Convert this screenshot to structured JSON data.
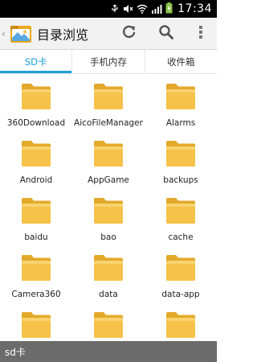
{
  "status_bar": {
    "time": "17:34",
    "icons": [
      "usb-icon",
      "mute-icon",
      "wifi-icon",
      "signal-icon",
      "battery-icon"
    ]
  },
  "action_bar": {
    "title": "目录浏览",
    "actions": [
      "refresh-icon",
      "search-icon",
      "overflow-menu-icon"
    ]
  },
  "tabs": [
    {
      "label": "SD卡",
      "active": true
    },
    {
      "label": "手机内存",
      "active": false
    },
    {
      "label": "收件箱",
      "active": false
    }
  ],
  "folders": [
    {
      "name": "360Download"
    },
    {
      "name": "AicoFileManager"
    },
    {
      "name": "Alarms"
    },
    {
      "name": "Android"
    },
    {
      "name": "AppGame"
    },
    {
      "name": "backups"
    },
    {
      "name": "baidu"
    },
    {
      "name": "bao"
    },
    {
      "name": "cache"
    },
    {
      "name": "Camera360"
    },
    {
      "name": "data"
    },
    {
      "name": "data-app"
    },
    {
      "name": ""
    },
    {
      "name": ""
    },
    {
      "name": ""
    }
  ],
  "path_bar": {
    "path": "sd卡"
  },
  "colors": {
    "accent": "#1e9fd8",
    "folder": "#f6c24a",
    "folder_dark": "#e3a92a",
    "path_bar": "#6b6b6b"
  }
}
